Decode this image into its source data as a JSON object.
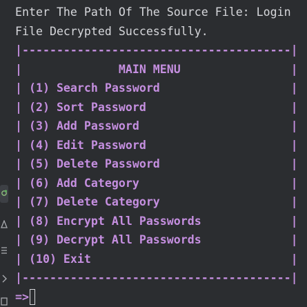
{
  "output": {
    "line1": "Enter The Path Of The Source File: Login",
    "line2": "File Decrypted Successfully."
  },
  "menu": {
    "border_top": "|---------------------------------------|",
    "title_line": "|              MAIN MENU                |",
    "items": [
      "| (1) Search Password                   |",
      "| (2) Sort Password                     |",
      "| (3) Add Password                      |",
      "| (4) Edit Password                     |",
      "| (5) Delete Password                   |",
      "| (6) Add Category                      |",
      "| (7) Delete Category                   |",
      "| (8) Encrypt All Passwords             |",
      "| (9) Decrypt All Passwords             |",
      "| (10) Exit                             |"
    ],
    "border_bottom": "|---------------------------------------|"
  },
  "input": {
    "prompt": "=>",
    "value": ""
  },
  "gutter_icons": [
    "run-status-icon",
    "warning-icon",
    "list-icon",
    "code-icon",
    "console-icon"
  ],
  "colors": {
    "background": "#2b2d30",
    "text": "#d6d7db",
    "menu": "#c58fe0"
  }
}
